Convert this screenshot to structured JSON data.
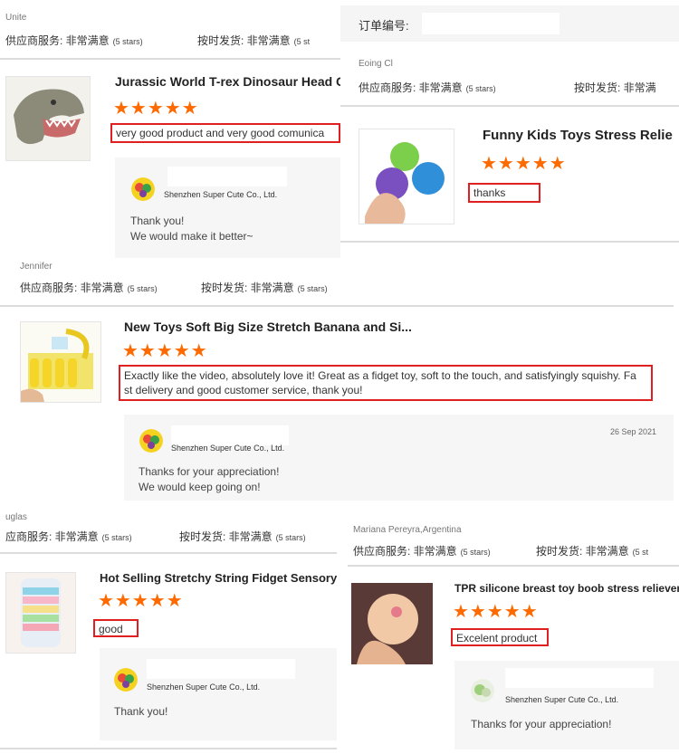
{
  "colors": {
    "star": "#ff6a00",
    "highlight_border": "#e02020",
    "reply_bg": "#f6f6f6"
  },
  "card1": {
    "reviewer": "Unite",
    "service_label": "供应商服务: 非常满意",
    "service_stars": "(5 stars)",
    "shipping_label": "按时发货: 非常满意",
    "shipping_stars": "(5 st",
    "product_title": "Jurassic World T-rex Dinosaur Head C",
    "product_image_icon": "dinosaur-head-icon",
    "stars": "★★★★★",
    "review": "very good product and very good comunica",
    "seller": "Shenzhen Super Cute Co., Ltd.",
    "reply_lines": [
      "Thank you!",
      "We would make it better~"
    ]
  },
  "card2": {
    "order_label": "订单编号:",
    "reviewer": "Eoing Cl",
    "service_label": "供应商服务: 非常满意",
    "service_stars": "(5 stars)",
    "shipping_label": "按时发货: 非常满",
    "product_title": "Funny Kids Toys Stress Relie",
    "product_image_icon": "stress-balls-icon",
    "stars": "★★★★★",
    "review": "thanks"
  },
  "card3": {
    "reviewer": "Jennifer",
    "service_label": "供应商服务: 非常满意",
    "service_stars": "(5 stars)",
    "shipping_label": "按时发货: 非常满意",
    "shipping_stars": "(5 stars)",
    "product_title": "New Toys Soft Big Size Stretch Banana and Si...",
    "product_image_icon": "banana-toys-icon",
    "stars": "★★★★★",
    "review_lines": [
      "Exactly like the video, absolutely love it!  Great as a fidget toy, soft to the touch, and satisfyingly squishy.  Fa",
      "st delivery and good customer service, thank you!"
    ],
    "date": "26 Sep 2021",
    "seller": "Shenzhen Super Cute Co., Ltd.",
    "reply_lines": [
      "Thanks for your appreciation!",
      "We would keep going on!"
    ]
  },
  "card4": {
    "reviewer": "uglas",
    "service_label": "应商服务: 非常满意",
    "service_stars": "(5 stars)",
    "shipping_label": "按时发货: 非常满意",
    "shipping_stars": "(5 stars)",
    "product_title": "Hot Selling Stretchy String Fidget Sensory",
    "product_image_icon": "string-fidget-icon",
    "stars": "★★★★★",
    "review": "good",
    "seller": "Shenzhen Super Cute Co., Ltd.",
    "reply_lines": [
      "Thank you!"
    ]
  },
  "card5": {
    "reviewer": "Mariana Pereyra,Argentina",
    "service_label": "供应商服务: 非常满意",
    "service_stars": "(5 stars)",
    "shipping_label": "按时发货: 非常满意",
    "shipping_stars": "(5 st",
    "product_title": "TPR silicone breast toy boob stress reliever",
    "product_image_icon": "silicone-ball-icon",
    "stars": "★★★★★",
    "review": "Excelent product",
    "seller": "Shenzhen Super Cute Co., Ltd.",
    "reply_lines": [
      "Thanks for your appreciation!"
    ]
  }
}
